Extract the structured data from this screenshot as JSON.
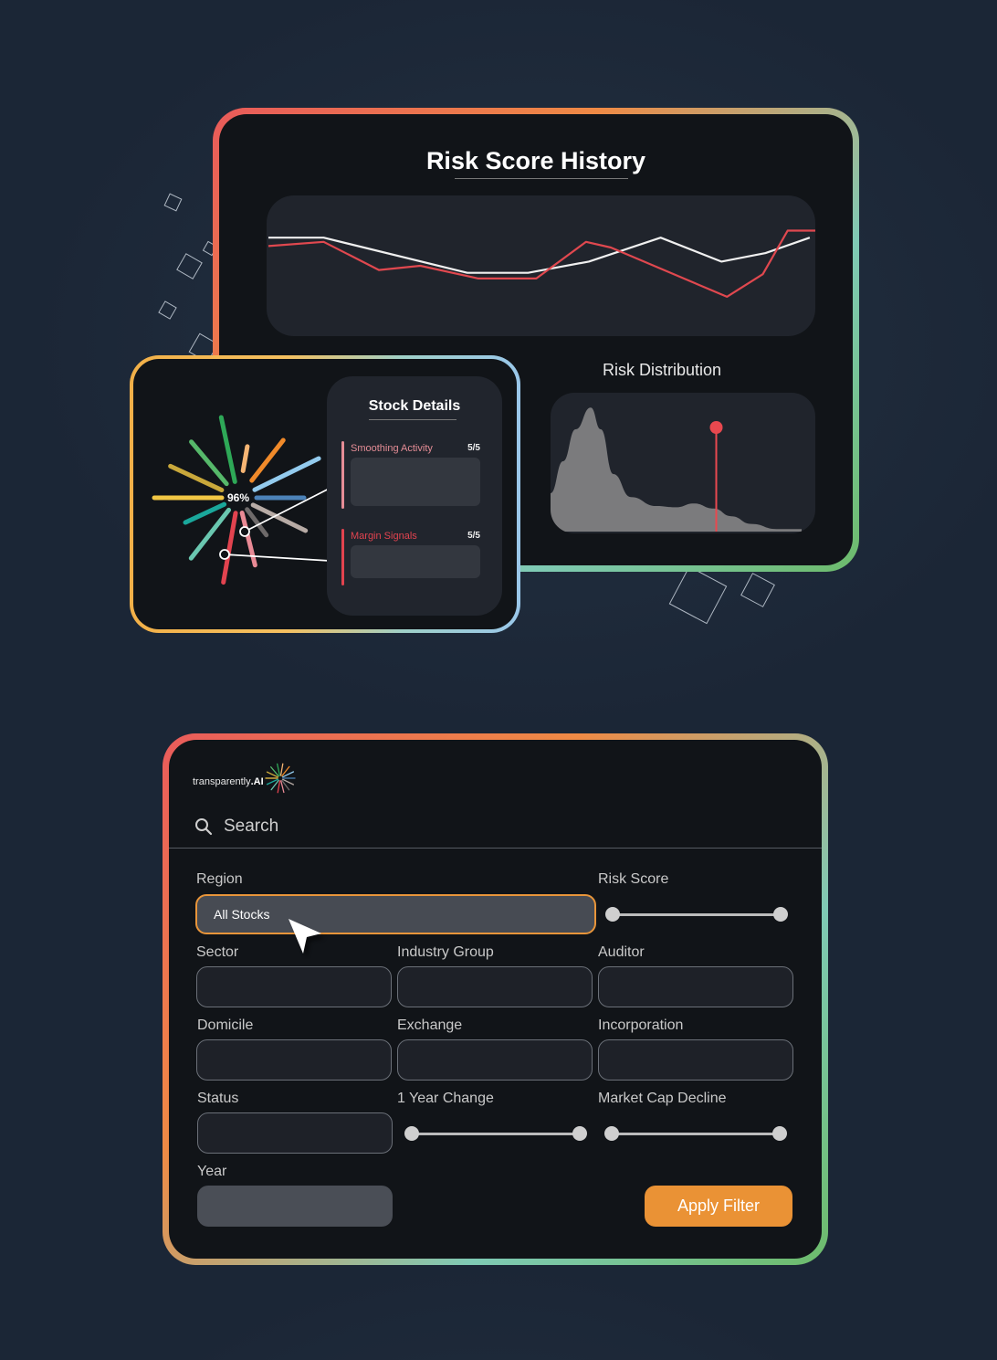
{
  "risk_history": {
    "title": "Risk Score History",
    "chart_data": {
      "type": "line",
      "title": "Risk Score History",
      "xlabel": "",
      "ylabel": "",
      "grid": false,
      "ylim": [
        0,
        100
      ],
      "x": [
        0,
        1,
        2,
        3,
        4,
        5,
        6,
        7,
        8,
        9,
        10,
        11,
        12
      ],
      "series": [
        {
          "name": "white",
          "color": "#f0f0f0",
          "points": [
            [
              0,
              70
            ],
            [
              1,
              70
            ],
            [
              3.6,
              45
            ],
            [
              4.7,
              45
            ],
            [
              5.8,
              53
            ],
            [
              7.1,
              70
            ],
            [
              8.2,
              53
            ],
            [
              9.0,
              59
            ],
            [
              9.8,
              70
            ]
          ]
        },
        {
          "name": "red",
          "color": "#e0484f",
          "points": [
            [
              0,
              64
            ],
            [
              1,
              67
            ],
            [
              2,
              47
            ],
            [
              2.75,
              50
            ],
            [
              3.8,
              41
            ],
            [
              4.85,
              41
            ],
            [
              5.75,
              67
            ],
            [
              6.2,
              63
            ],
            [
              8.3,
              28
            ],
            [
              8.95,
              44
            ],
            [
              9.4,
              75
            ],
            [
              9.9,
              75
            ]
          ]
        }
      ]
    }
  },
  "risk_distribution": {
    "title": "Risk Distribution",
    "chart_data": {
      "type": "area",
      "title": "Risk Distribution",
      "xlim": [
        0,
        100
      ],
      "ylim": [
        0,
        100
      ],
      "density": [
        [
          0,
          30
        ],
        [
          5,
          55
        ],
        [
          10,
          80
        ],
        [
          16,
          97
        ],
        [
          20,
          80
        ],
        [
          25,
          45
        ],
        [
          32,
          27
        ],
        [
          42,
          20
        ],
        [
          50,
          19
        ],
        [
          57,
          22
        ],
        [
          65,
          18
        ],
        [
          72,
          12
        ],
        [
          80,
          6
        ],
        [
          90,
          2
        ],
        [
          100,
          2
        ]
      ],
      "marker": {
        "x": 66,
        "color": "#e8484f"
      }
    }
  },
  "stock_score": {
    "percent_label": "96%",
    "rays": [
      {
        "color": "#f2c744"
      },
      {
        "color": "#c9a83b"
      },
      {
        "color": "#56b86a"
      },
      {
        "color": "#2ea857"
      },
      {
        "color": "#f5b574"
      },
      {
        "color": "#f08a2a"
      },
      {
        "color": "#93cbee"
      },
      {
        "color": "#4c82b8"
      },
      {
        "color": "#b7aba5"
      },
      {
        "color": "#6e6a6a"
      },
      {
        "color": "#e98a95"
      },
      {
        "color": "#e2434f"
      },
      {
        "color": "#6ac7b0"
      },
      {
        "color": "#1aa79b"
      }
    ]
  },
  "stock_details": {
    "title": "Stock Details",
    "metrics": [
      {
        "label": "Smoothing Activity",
        "value": "5/5",
        "color": "#e58d96"
      },
      {
        "label": "Margin Signals",
        "value": "5/5",
        "color": "#e2434f"
      }
    ]
  },
  "filter_panel": {
    "logo_text": "transparently",
    "logo_suffix": ".AI",
    "search_placeholder": "Search",
    "fields": {
      "region": {
        "label": "Region",
        "value": "All Stocks"
      },
      "risk_score": {
        "label": "Risk Score",
        "range": [
          0,
          100
        ]
      },
      "sector": {
        "label": "Sector",
        "value": ""
      },
      "industry_group": {
        "label": "Industry Group",
        "value": ""
      },
      "auditor": {
        "label": "Auditor",
        "value": ""
      },
      "domicile": {
        "label": "Domicile",
        "value": ""
      },
      "exchange": {
        "label": "Exchange",
        "value": ""
      },
      "incorporation": {
        "label": "Incorporation",
        "value": ""
      },
      "status": {
        "label": "Status",
        "value": ""
      },
      "year_change": {
        "label": "1 Year Change",
        "range": [
          0,
          100
        ]
      },
      "market_cap_decline": {
        "label": "Market Cap Decline",
        "range": [
          0,
          100
        ]
      },
      "year": {
        "label": "Year",
        "value": ""
      }
    },
    "apply_label": "Apply Filter",
    "accent_color": "#ea9235"
  }
}
